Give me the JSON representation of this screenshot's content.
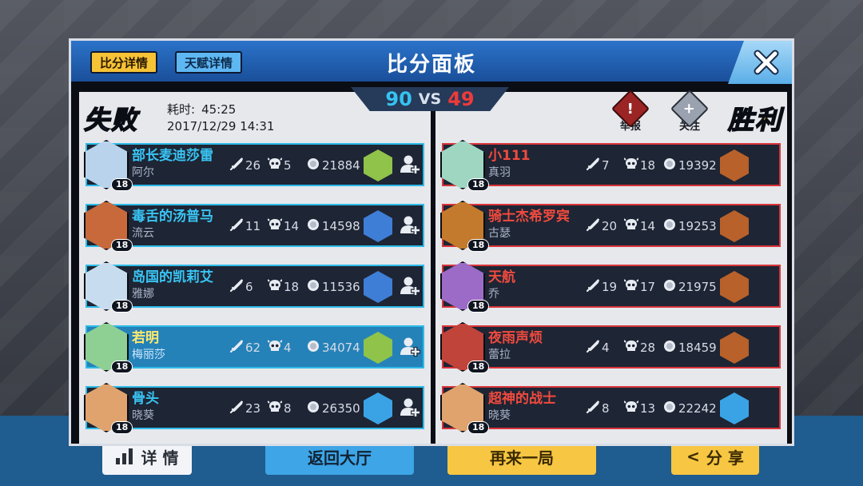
{
  "background": {
    "buttons": {
      "details": "详 情",
      "lobby": "返回大厅",
      "again": "再来一局",
      "share": "分 享"
    }
  },
  "header": {
    "tab_active": "比分详情",
    "tab_inactive": "天赋详情",
    "title": "比分面板",
    "close_icon": "close-icon"
  },
  "score": {
    "left": "90",
    "vs": "VS",
    "right": "49"
  },
  "left_team": {
    "result": "失败",
    "duration_label": "耗时:",
    "duration": "45:25",
    "datetime": "2017/12/29 14:31",
    "players": [
      {
        "hero": "部长麦迪莎雷",
        "player": "阿尔",
        "level": "18",
        "kills": "26",
        "deaths": "5",
        "gold": "21884",
        "avatar_color": "#b9d3ec",
        "equip_color": "#8fc34a"
      },
      {
        "hero": "毒舌的汤普马",
        "player": "流云",
        "level": "18",
        "kills": "11",
        "deaths": "14",
        "gold": "14598",
        "avatar_color": "#c7693b",
        "equip_color": "#3e7ed6"
      },
      {
        "hero": "岛国的凯莉艾",
        "player": "雅娜",
        "level": "18",
        "kills": "6",
        "deaths": "18",
        "gold": "11536",
        "avatar_color": "#c8dcef",
        "equip_color": "#3e7ed6"
      },
      {
        "hero": "若明",
        "player": "梅丽莎",
        "level": "18",
        "kills": "62",
        "deaths": "4",
        "gold": "34074",
        "avatar_color": "#8ecf94",
        "equip_color": "#8fc34a"
      },
      {
        "hero": "骨头",
        "player": "晓葵",
        "level": "18",
        "kills": "23",
        "deaths": "8",
        "gold": "26350",
        "avatar_color": "#e0a36e",
        "equip_color": "#3aa3e6"
      }
    ]
  },
  "right_team": {
    "result": "胜利",
    "report_label": "举报",
    "follow_label": "关注",
    "players": [
      {
        "hero": "小111",
        "player": "真羽",
        "level": "18",
        "kills": "7",
        "deaths": "18",
        "gold": "19392",
        "avatar_color": "#9fd6c2",
        "equip_color": "#b8612a"
      },
      {
        "hero": "骑士杰希罗宾",
        "player": "古瑟",
        "level": "18",
        "kills": "20",
        "deaths": "14",
        "gold": "19253",
        "avatar_color": "#c47a2c",
        "equip_color": "#b8612a"
      },
      {
        "hero": "天航",
        "player": "乔",
        "level": "18",
        "kills": "19",
        "deaths": "17",
        "gold": "21975",
        "avatar_color": "#9c6bc7",
        "equip_color": "#b8612a"
      },
      {
        "hero": "夜雨声烦",
        "player": "蕾拉",
        "level": "18",
        "kills": "4",
        "deaths": "28",
        "gold": "18459",
        "avatar_color": "#c0443a",
        "equip_color": "#b8612a"
      },
      {
        "hero": "超神的战士",
        "player": "晓葵",
        "level": "18",
        "kills": "8",
        "deaths": "13",
        "gold": "22242",
        "avatar_color": "#e0a36e",
        "equip_color": "#3aa3e6"
      }
    ]
  },
  "colors": {
    "left_accent": "#2dbbe8",
    "right_accent": "#d8343a",
    "score_left": "#35c3f2",
    "score_right": "#ef3a3a"
  }
}
